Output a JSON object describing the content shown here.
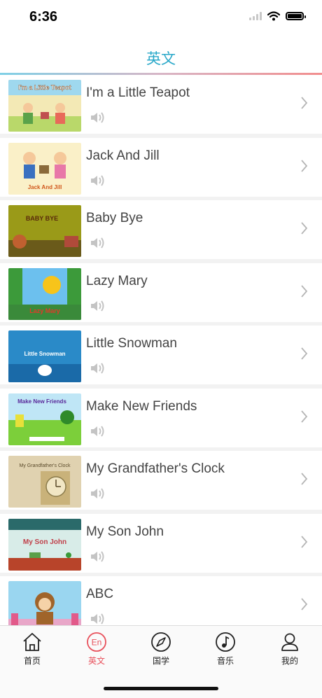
{
  "status_bar": {
    "time": "6:36"
  },
  "header": {
    "title": "英文"
  },
  "songs": [
    {
      "title": "I'm a Little Teapot",
      "thumb_text": "I'm a Little Teapot"
    },
    {
      "title": "Jack And Jill",
      "thumb_text": "Jack And Jill"
    },
    {
      "title": "Baby Bye",
      "thumb_text": "BABY BYE"
    },
    {
      "title": "Lazy Mary",
      "thumb_text": "Lazy Mary"
    },
    {
      "title": "Little Snowman",
      "thumb_text": "Little Snowman"
    },
    {
      "title": "Make New Friends",
      "thumb_text": "Make New Friends"
    },
    {
      "title": "My Grandfather's Clock",
      "thumb_text": "My Grandfather's Clock"
    },
    {
      "title": "My Son John",
      "thumb_text": "My Son John"
    },
    {
      "title": "ABC",
      "thumb_text": ""
    }
  ],
  "tab_bar": {
    "items": [
      {
        "label": "首页",
        "icon": "home-icon"
      },
      {
        "label": "英文",
        "icon": "en-icon",
        "icon_text": "En",
        "active": true
      },
      {
        "label": "国学",
        "icon": "compass-icon"
      },
      {
        "label": "音乐",
        "icon": "music-note-icon"
      },
      {
        "label": "我的",
        "icon": "person-icon"
      }
    ]
  },
  "colors": {
    "accent": "#2aa8c9",
    "active_tab": "#e8505b",
    "divider_gradient": [
      "#7fd0e6",
      "#f28e8e"
    ]
  }
}
